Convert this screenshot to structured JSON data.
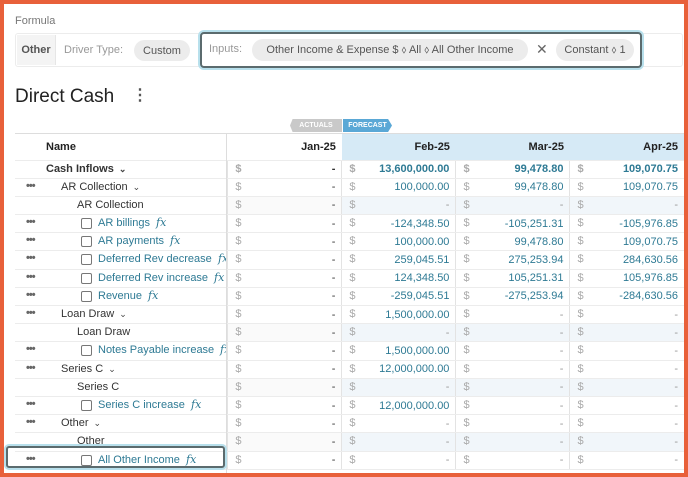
{
  "formula": {
    "title": "Formula",
    "type_chip": "Other",
    "driver_label": "Driver Type:",
    "driver_value": "Custom",
    "inputs_label": "Inputs:",
    "input_chip": "Other Income & Expense $ ⬨ All ⬨ All Other Income",
    "clear_symbol": "✕",
    "constant_chip": "Constant ⬨ 1"
  },
  "page": {
    "title": "Direct Cash",
    "menu_symbol": "⋮"
  },
  "flags": {
    "actuals": "ACTUALS",
    "forecast": "FORECAST"
  },
  "columns": [
    "Name",
    "Jan-25",
    "Feb-25",
    "Mar-25",
    "Apr-25"
  ],
  "icons": {
    "row_menu": "ellipsis-icon",
    "fx": "fx-icon",
    "chevron": "chevron-down-icon"
  },
  "rows": [
    {
      "name": "Cash Inflows",
      "kind": "total",
      "chevron": "⌄",
      "jan": "-",
      "feb": "13,600,000.00",
      "mar": "99,478.80",
      "apr": "109,070.75"
    },
    {
      "name": "AR Collection",
      "kind": "group",
      "chevron": "⌄",
      "menu": "•••",
      "jan": "-",
      "feb": "100,000.00",
      "mar": "99,478.80",
      "apr": "109,070.75"
    },
    {
      "name": "AR Collection",
      "kind": "sub",
      "jan": "-",
      "feb": "-",
      "mar": "-",
      "apr": "-"
    },
    {
      "name": "AR billings",
      "kind": "item",
      "menu": "•••",
      "fx": "fx",
      "jan": "-",
      "feb": "-124,348.50",
      "mar": "-105,251.31",
      "apr": "-105,976.85"
    },
    {
      "name": "AR payments",
      "kind": "item",
      "menu": "•••",
      "fx": "fx",
      "jan": "-",
      "feb": "100,000.00",
      "mar": "99,478.80",
      "apr": "109,070.75"
    },
    {
      "name": "Deferred Rev decrease",
      "kind": "item",
      "menu": "•••",
      "fx": "fx",
      "jan": "-",
      "feb": "259,045.51",
      "mar": "275,253.94",
      "apr": "284,630.56"
    },
    {
      "name": "Deferred Rev increase",
      "kind": "item",
      "menu": "•••",
      "fx": "fx",
      "jan": "-",
      "feb": "124,348.50",
      "mar": "105,251.31",
      "apr": "105,976.85"
    },
    {
      "name": "Revenue",
      "kind": "item",
      "menu": "•••",
      "fx": "fx",
      "jan": "-",
      "feb": "-259,045.51",
      "mar": "-275,253.94",
      "apr": "-284,630.56"
    },
    {
      "name": "Loan Draw",
      "kind": "group",
      "chevron": "⌄",
      "menu": "•••",
      "jan": "-",
      "feb": "1,500,000.00",
      "mar": "-",
      "apr": "-"
    },
    {
      "name": "Loan Draw",
      "kind": "sub",
      "jan": "-",
      "feb": "-",
      "mar": "-",
      "apr": "-"
    },
    {
      "name": "Notes Payable increase",
      "kind": "item",
      "menu": "•••",
      "fx": "fx",
      "jan": "-",
      "feb": "1,500,000.00",
      "mar": "-",
      "apr": "-"
    },
    {
      "name": "Series C",
      "kind": "group",
      "chevron": "⌄",
      "menu": "•••",
      "jan": "-",
      "feb": "12,000,000.00",
      "mar": "-",
      "apr": "-"
    },
    {
      "name": "Series C",
      "kind": "sub",
      "jan": "-",
      "feb": "-",
      "mar": "-",
      "apr": "-"
    },
    {
      "name": "Series C increase",
      "kind": "item",
      "menu": "•••",
      "fx": "fx",
      "jan": "-",
      "feb": "12,000,000.00",
      "mar": "-",
      "apr": "-"
    },
    {
      "name": "Other",
      "kind": "group",
      "chevron": "⌄",
      "menu": "•••",
      "jan": "-",
      "feb": "-",
      "mar": "-",
      "apr": "-"
    },
    {
      "name": "Other",
      "kind": "sub",
      "jan": "-",
      "feb": "-",
      "mar": "-",
      "apr": "-"
    },
    {
      "name": "All Other Income",
      "kind": "item",
      "menu": "•••",
      "fx": "fx",
      "jan": "-",
      "feb": "-",
      "mar": "-",
      "apr": "-"
    }
  ],
  "currency_symbol": "$",
  "colors": {
    "accent": "#5aa8d6",
    "link": "#2e7a94",
    "border_frame": "#e8603a"
  }
}
